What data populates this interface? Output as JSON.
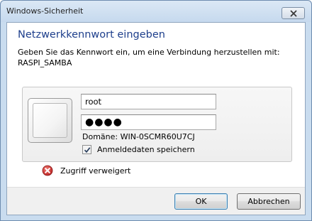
{
  "window": {
    "title": "Windows-Sicherheit"
  },
  "dialog": {
    "heading": "Netzwerkkennwort eingeben",
    "description_line1": "Geben Sie das Kennwort ein, um eine Verbindung herzustellen mit:",
    "description_line2": "RASPI_SAMBA"
  },
  "credentials": {
    "username_value": "root",
    "password_value": "●●●●",
    "domain_text": "Domäne: WIN-0SCMR60U7CJ",
    "remember_label": "Anmeldedaten speichern",
    "remember_checked": true
  },
  "status": {
    "error_text": "Zugriff verweigert"
  },
  "buttons": {
    "ok_label": "OK",
    "cancel_label": "Abbrechen"
  },
  "icons": {
    "close": "close-icon",
    "user_tile": "user-tile-icon",
    "checkmark": "checkmark-icon",
    "error": "error-icon"
  },
  "colors": {
    "heading": "#1e3f8c",
    "frame": "#c9dcef",
    "error_red": "#c8282a"
  }
}
